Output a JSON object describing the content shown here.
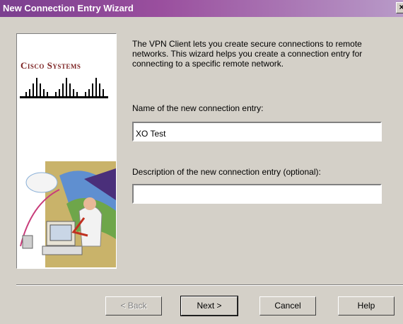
{
  "window": {
    "title": "New Connection Entry Wizard",
    "close_glyph": "×"
  },
  "logo": {
    "text": "Cisco Systems"
  },
  "intro_text": "The VPN Client lets you create secure connections to remote networks. This wizard helps you create a connection entry for connecting to a specific remote network.",
  "name_field": {
    "label": "Name of the new connection entry:",
    "value": "XO Test"
  },
  "description_field": {
    "label": "Description of the new connection entry (optional):",
    "value": ""
  },
  "buttons": {
    "back": "< Back",
    "next": "Next >",
    "cancel": "Cancel",
    "help": "Help"
  },
  "colors": {
    "titlebar": "#9a4f9e",
    "logo": "#7a1f1f",
    "dialog": "#d4d0c8"
  }
}
